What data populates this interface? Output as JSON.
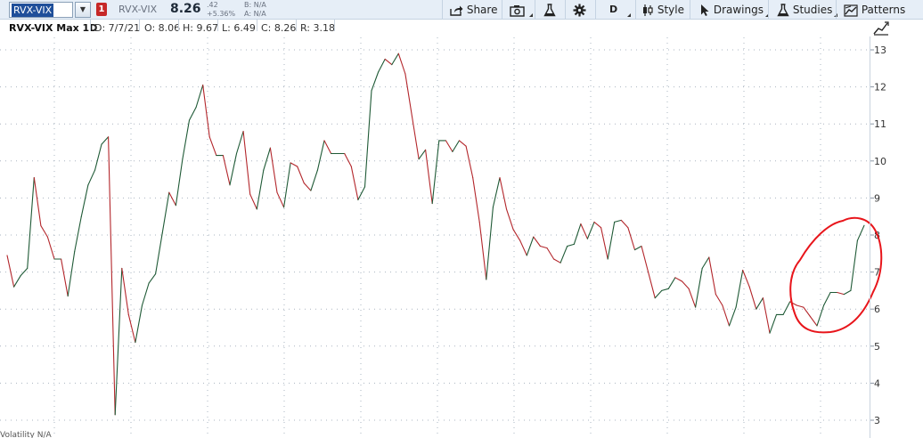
{
  "toolbar": {
    "symbol": "RVX-VIX",
    "flag": "1",
    "description": "RVX-VIX",
    "last": "8.26",
    "net_change": ".42",
    "pct_change": "+5.36%",
    "bid": "B: N/A",
    "ask": "A: N/A",
    "share_label": "Share",
    "aggregation": "D",
    "style_label": "Style",
    "drawings_label": "Drawings",
    "studies_label": "Studies",
    "patterns_label": "Patterns"
  },
  "infobar": {
    "title": "RVX-VIX Max 1D",
    "date": "D: 7/7/21",
    "open": "O: 8.06",
    "high": "H: 9.67",
    "low": "L: 6.49",
    "close": "C: 8.26",
    "range": "R: 3.18"
  },
  "bottom_tab": "Volatility  N/A",
  "colors": {
    "up": "#1f5a36",
    "down": "#b3262b",
    "annotation": "#e8151b",
    "grid": "#aab4c0"
  },
  "chart_data": {
    "type": "line",
    "ylim": [
      2.8,
      13.3
    ],
    "y_ticks": [
      3,
      4,
      5,
      6,
      7,
      8,
      9,
      10,
      11,
      12,
      13
    ],
    "grid": true,
    "legend": "none",
    "series": [
      {
        "y": [
          7.45,
          6.6,
          6.9,
          7.1,
          9.55,
          8.25,
          7.95,
          7.35,
          7.35,
          6.35,
          7.55,
          8.5,
          9.35,
          9.75,
          10.45,
          10.65,
          3.15,
          7.1,
          5.85,
          5.1,
          6.1,
          6.7,
          6.95,
          8.05,
          9.15,
          8.8,
          10.05,
          11.1,
          11.45,
          12.05,
          10.65,
          10.15,
          10.15,
          9.35,
          10.2,
          10.8,
          9.1,
          8.7,
          9.75,
          10.35,
          9.15,
          8.75,
          9.95,
          9.85,
          9.4,
          9.2,
          9.75,
          10.55,
          10.2,
          10.2,
          10.2,
          9.85,
          8.95,
          9.3,
          11.9,
          12.4,
          12.75,
          12.6,
          12.9,
          12.35,
          11.2,
          10.05,
          10.3,
          8.85,
          10.55,
          10.55,
          10.25,
          10.55,
          10.4,
          9.55,
          8.35,
          6.8,
          8.75,
          9.55,
          8.7,
          8.15,
          7.85,
          7.45,
          7.95,
          7.7,
          7.65,
          7.35,
          7.25,
          7.7,
          7.75,
          8.3,
          7.9,
          8.35,
          8.2,
          7.35,
          8.35,
          8.4,
          8.2,
          7.6,
          7.7,
          7.0,
          6.3,
          6.5,
          6.55,
          6.85,
          6.75,
          6.55,
          6.05,
          7.1,
          7.4,
          6.4,
          6.1,
          5.55,
          6.05,
          7.05,
          6.6,
          6.0,
          6.3,
          5.35,
          5.85,
          5.85,
          6.2,
          6.1,
          6.05,
          5.8,
          5.55,
          6.1,
          6.45,
          6.45,
          6.4,
          6.5,
          7.85,
          8.26
        ]
      }
    ]
  }
}
